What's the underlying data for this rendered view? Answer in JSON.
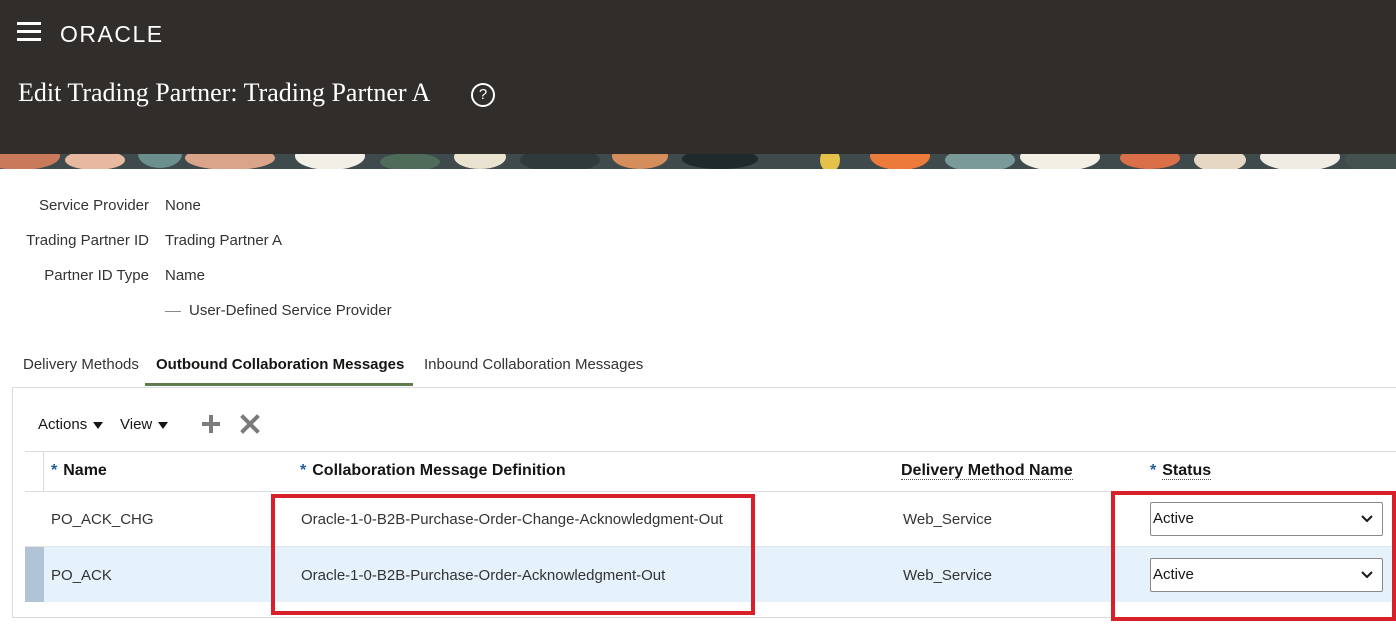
{
  "header": {
    "logo": "ORACLE",
    "title": "Edit Trading Partner: Trading Partner A",
    "help_glyph": "?"
  },
  "details": {
    "service_provider_label": "Service Provider",
    "service_provider_value": "None",
    "trading_partner_id_label": "Trading Partner ID",
    "trading_partner_id_value": "Trading Partner A",
    "partner_id_type_label": "Partner ID Type",
    "partner_id_type_value": "Name",
    "user_defined_label": "User-Defined Service Provider"
  },
  "tabs": [
    {
      "label": "Delivery Methods",
      "active": false
    },
    {
      "label": "Outbound Collaboration Messages",
      "active": true
    },
    {
      "label": "Inbound Collaboration Messages",
      "active": false
    }
  ],
  "toolbar": {
    "actions_label": "Actions",
    "view_label": "View",
    "add_icon": "plus-icon",
    "delete_icon": "close-icon"
  },
  "table": {
    "required_marker": "*",
    "columns": [
      "Name",
      "Collaboration Message Definition",
      "Delivery Method Name",
      "Status"
    ],
    "rows": [
      {
        "name": "PO_ACK_CHG",
        "definition": "Oracle-1-0-B2B-Purchase-Order-Change-Acknowledgment-Out",
        "delivery_method": "Web_Service",
        "status": "Active",
        "selected": false
      },
      {
        "name": "PO_ACK",
        "definition": "Oracle-1-0-B2B-Purchase-Order-Acknowledgment-Out",
        "delivery_method": "Web_Service",
        "status": "Active",
        "selected": true
      }
    ]
  },
  "colors": {
    "header_bg": "#312d2a",
    "tab_active_underline": "#5f7d4f",
    "required_asterisk": "#1c5e9c",
    "selected_row_bg": "#e5f1fb",
    "highlight_box": "#d7202a"
  }
}
